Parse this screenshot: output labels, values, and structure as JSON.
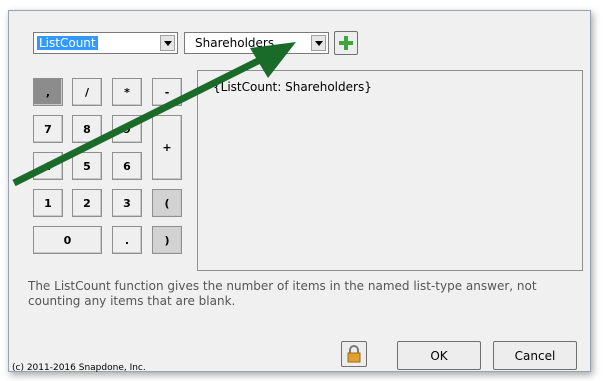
{
  "toolbar": {
    "function_value": "ListCount",
    "variable_value": "Shareholders",
    "add_icon": "green-plus-icon"
  },
  "keypad": {
    "keys": [
      ",",
      "/",
      "*",
      "-",
      "7",
      "8",
      "9",
      "+",
      "4",
      "5",
      "6",
      "1",
      "2",
      "3",
      "(",
      "0",
      ".",
      ")"
    ]
  },
  "editor": {
    "expression": "{ListCount: Shareholders}"
  },
  "description": "The ListCount function gives the number of items in the named list-type answer, not counting any items that are blank.",
  "buttons": {
    "ok_label": "OK",
    "cancel_label": "Cancel",
    "lock_icon": "padlock-icon"
  },
  "copyright": "(c) 2011-2016 Snapdone, Inc.",
  "colors": {
    "annotation_arrow": "#1a6b2a",
    "selection": "#3399ff"
  }
}
